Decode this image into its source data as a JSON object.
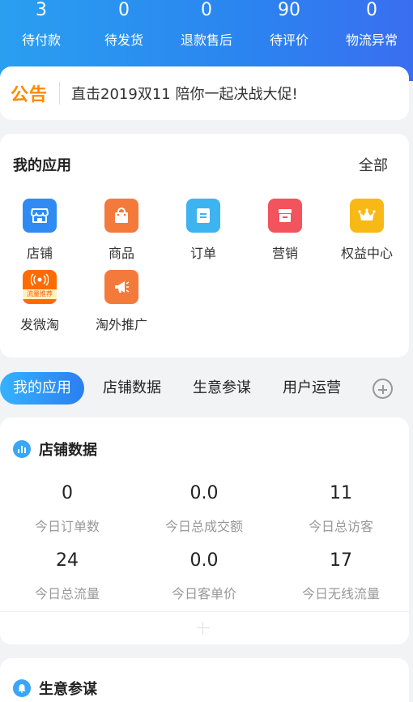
{
  "stats": [
    {
      "value": "3",
      "label": "待付款"
    },
    {
      "value": "0",
      "label": "待发货"
    },
    {
      "value": "0",
      "label": "退款售后"
    },
    {
      "value": "90",
      "label": "待评价"
    },
    {
      "value": "0",
      "label": "物流异常"
    }
  ],
  "notice": {
    "badge": "公告",
    "text": "直击2019双11 陪你一起决战大促!"
  },
  "my_apps": {
    "title": "我的应用",
    "all_label": "全部",
    "items": [
      {
        "label": "店铺",
        "icon": "store-icon",
        "color": "#2f8bf3"
      },
      {
        "label": "商品",
        "icon": "shopping-bag-icon",
        "color": "#f47a3c"
      },
      {
        "label": "订单",
        "icon": "order-icon",
        "color": "#3db3f0"
      },
      {
        "label": "营销",
        "icon": "marketing-icon",
        "color": "#f2535c"
      },
      {
        "label": "权益中心",
        "icon": "crown-icon",
        "color": "#f8b916"
      },
      {
        "label": "发微淘",
        "icon": "weitao-icon",
        "color": "#ff6b00",
        "icon_text": "流量推荐"
      },
      {
        "label": "淘外推广",
        "icon": "megaphone-icon",
        "color": "#f47a3c"
      }
    ]
  },
  "tabs": [
    {
      "label": "我的应用",
      "active": true
    },
    {
      "label": "店铺数据",
      "active": false
    },
    {
      "label": "生意参谋",
      "active": false
    },
    {
      "label": "用户运营",
      "active": false
    }
  ],
  "store_data": {
    "title": "店铺数据",
    "metrics": [
      {
        "value": "0",
        "label": "今日订单数"
      },
      {
        "value": "0.0",
        "label": "今日总成交额"
      },
      {
        "value": "11",
        "label": "今日总访客"
      },
      {
        "value": "24",
        "label": "今日总流量"
      },
      {
        "value": "0.0",
        "label": "今日客单价"
      },
      {
        "value": "17",
        "label": "今日无线流量"
      }
    ]
  },
  "business": {
    "title": "生意参谋"
  }
}
